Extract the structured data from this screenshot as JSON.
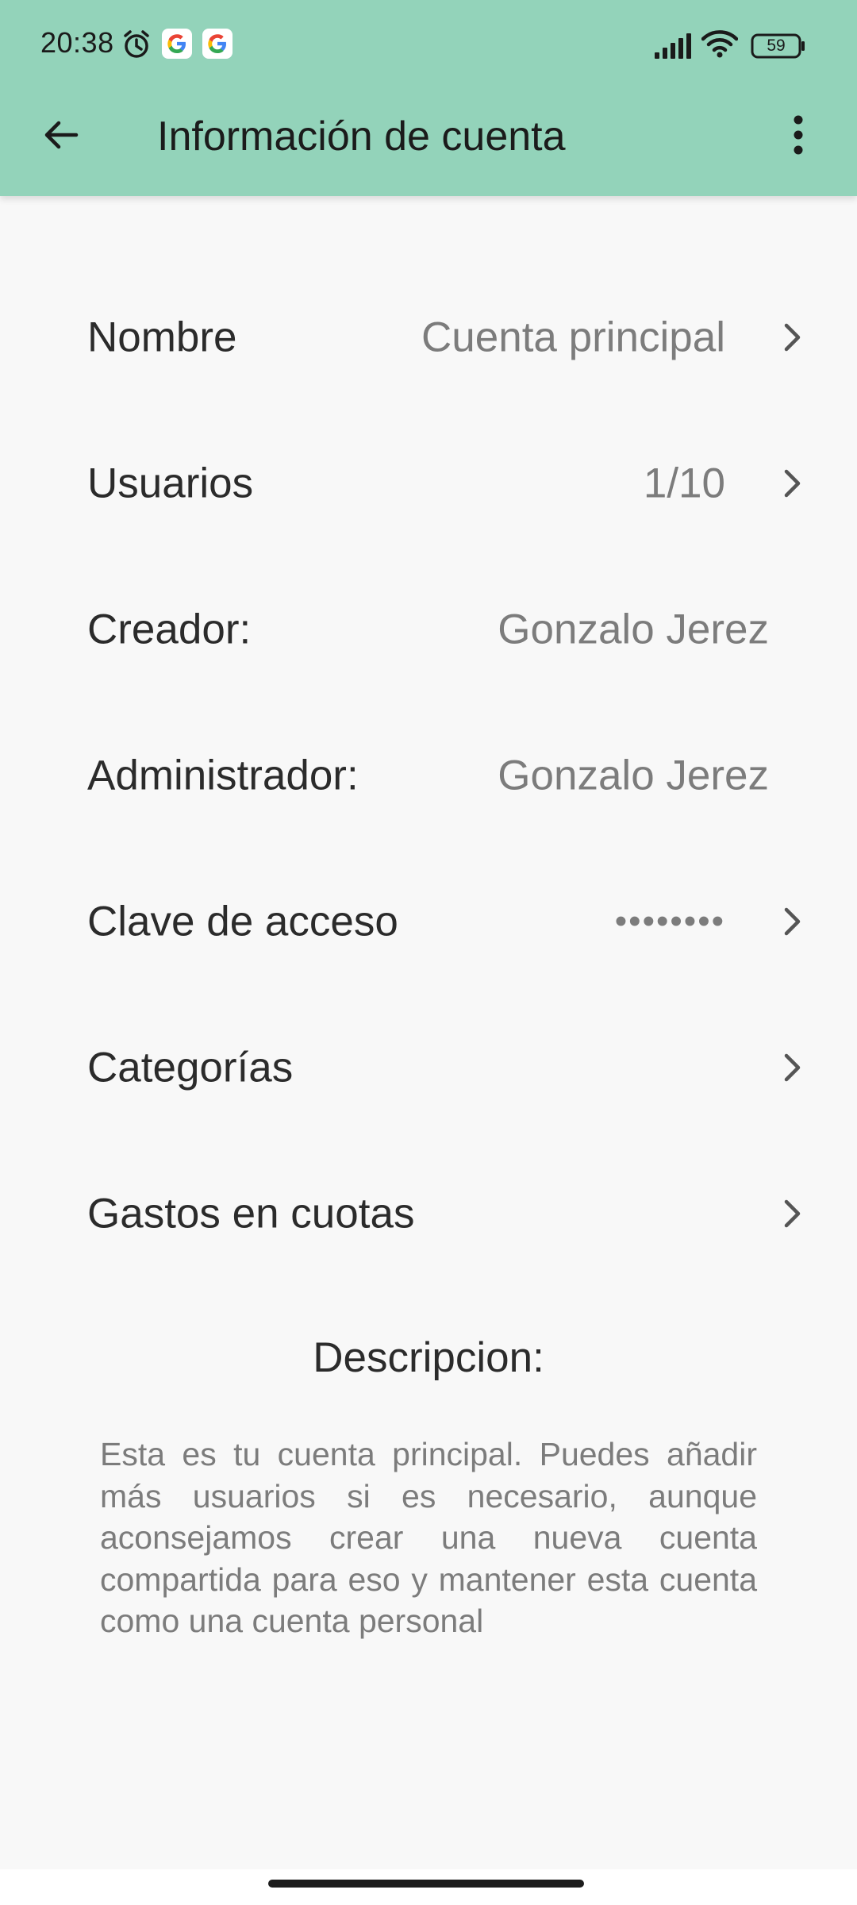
{
  "status_bar": {
    "time": "20:38",
    "battery": "59",
    "icons": [
      "alarm-icon",
      "google-icon",
      "google-icon",
      "signal-icon",
      "wifi-icon",
      "battery-icon"
    ]
  },
  "app_bar": {
    "title": "Información de cuenta",
    "back_icon": "arrow-left-icon",
    "menu_icon": "more-vertical-icon",
    "color": "#93d3ba"
  },
  "rows": [
    {
      "label": "Nombre",
      "value": "Cuenta principal",
      "chevron": true
    },
    {
      "label": "Usuarios",
      "value": "1/10",
      "chevron": true
    },
    {
      "label": "Creador:",
      "value": "Gonzalo Jerez",
      "chevron": false
    },
    {
      "label": "Administrador:",
      "value": "Gonzalo Jerez",
      "chevron": false
    },
    {
      "label": "Clave de acceso",
      "value": "••••••••",
      "chevron": true
    },
    {
      "label": "Categorías",
      "value": "",
      "chevron": true
    },
    {
      "label": "Gastos en cuotas",
      "value": "",
      "chevron": true
    }
  ],
  "description": {
    "title": "Descripcion:",
    "text": "Esta es tu cuenta principal. Puedes añadir más usuarios si es necesario, aunque aconsejamos crear una nueva cuenta compartida para eso y mantener esta cuenta como una cuenta personal"
  }
}
